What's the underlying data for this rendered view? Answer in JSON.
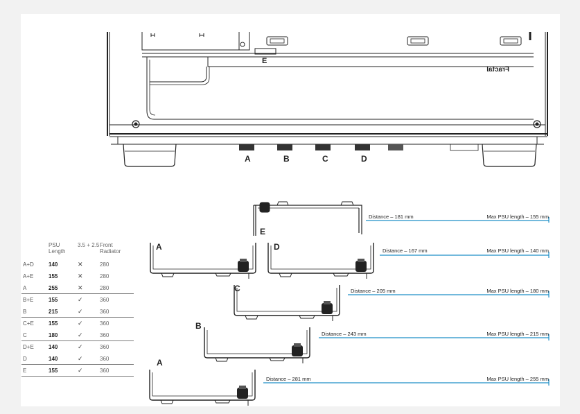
{
  "case_labels": {
    "e_top": "E",
    "a": "A",
    "b": "B",
    "c": "C",
    "d": "D"
  },
  "logo_text": "Fractal",
  "mounts": [
    {
      "letter": "E",
      "distance": "Distance – 181 mm",
      "max_psu": "Max PSU length – 155 mm"
    },
    {
      "letter": "D",
      "distance": "Distance – 167 mm",
      "max_psu": "Max PSU length – 140 mm"
    },
    {
      "letter": "C",
      "distance": "Distance – 205 mm",
      "max_psu": "Max PSU length – 180 mm"
    },
    {
      "letter": "B",
      "distance": "Distance – 243 mm",
      "max_psu": "Max PSU length – 215 mm"
    },
    {
      "letter": "A",
      "distance": "Distance – 281 mm",
      "max_psu": "Max PSU length – 255 mm"
    }
  ],
  "mount_a_upper": "A",
  "table": {
    "headers": [
      "",
      "PSU Length",
      "3.5 + 2.5",
      "Front Radiator"
    ],
    "rows": [
      [
        "A+D",
        "140",
        "✕",
        "280"
      ],
      [
        "A+E",
        "155",
        "✕",
        "280"
      ],
      [
        "A",
        "255",
        "✕",
        "280"
      ],
      [
        "B+E",
        "155",
        "✓",
        "360"
      ],
      [
        "B",
        "215",
        "✓",
        "360"
      ],
      [
        "C+E",
        "155",
        "✓",
        "360"
      ],
      [
        "C",
        "180",
        "✓",
        "360"
      ],
      [
        "D+E",
        "140",
        "✓",
        "360"
      ],
      [
        "D",
        "140",
        "✓",
        "360"
      ],
      [
        "E",
        "155",
        "✓",
        "360"
      ]
    ]
  },
  "colors": {
    "line": "#222222",
    "dimension": "#1f8fc7",
    "background": "#ffffff"
  }
}
